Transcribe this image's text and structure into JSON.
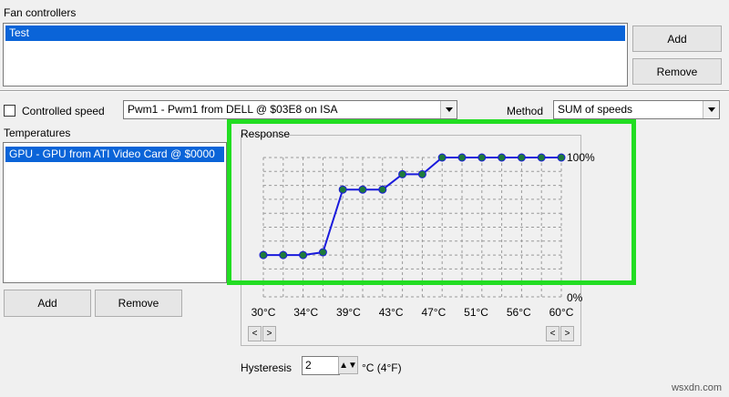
{
  "fan_controllers": {
    "title": "Fan controllers",
    "items": [
      "Test"
    ],
    "add_label": "Add",
    "remove_label": "Remove"
  },
  "controlled_speed": {
    "label": "Controlled speed",
    "checked": false,
    "value": "Pwm1 - Pwm1 from DELL @ $03E8 on ISA"
  },
  "method": {
    "label": "Method",
    "value": "SUM of speeds"
  },
  "temperatures": {
    "title": "Temperatures",
    "items": [
      "GPU - GPU from ATI Video Card @ $0000"
    ],
    "add_label": "Add",
    "remove_label": "Remove"
  },
  "response": {
    "title": "Response",
    "max_label": "100%",
    "min_label": "0%",
    "ticks": [
      "30°C",
      "34°C",
      "39°C",
      "43°C",
      "47°C",
      "51°C",
      "56°C",
      "60°C"
    ],
    "left_nav": [
      "<",
      ">"
    ],
    "right_nav": [
      "<",
      ">"
    ],
    "line_color": "#1a1adc",
    "point_color": "#1e7a3c",
    "frame_color": "#22dd22"
  },
  "chart_data": {
    "type": "line",
    "x": [
      30,
      32,
      34,
      36,
      38,
      40,
      42,
      44,
      46,
      48,
      50,
      52,
      54,
      56,
      58,
      60
    ],
    "y": [
      30,
      30,
      30,
      32,
      77,
      77,
      77,
      88,
      88,
      100,
      100,
      100,
      100,
      100,
      100,
      100
    ],
    "xlim": [
      30,
      60
    ],
    "ylim": [
      0,
      100
    ],
    "grid": true
  },
  "hysteresis": {
    "label": "Hysteresis",
    "value": "2",
    "unit": "°C (4°F)"
  },
  "watermark": "wsxdn.com"
}
